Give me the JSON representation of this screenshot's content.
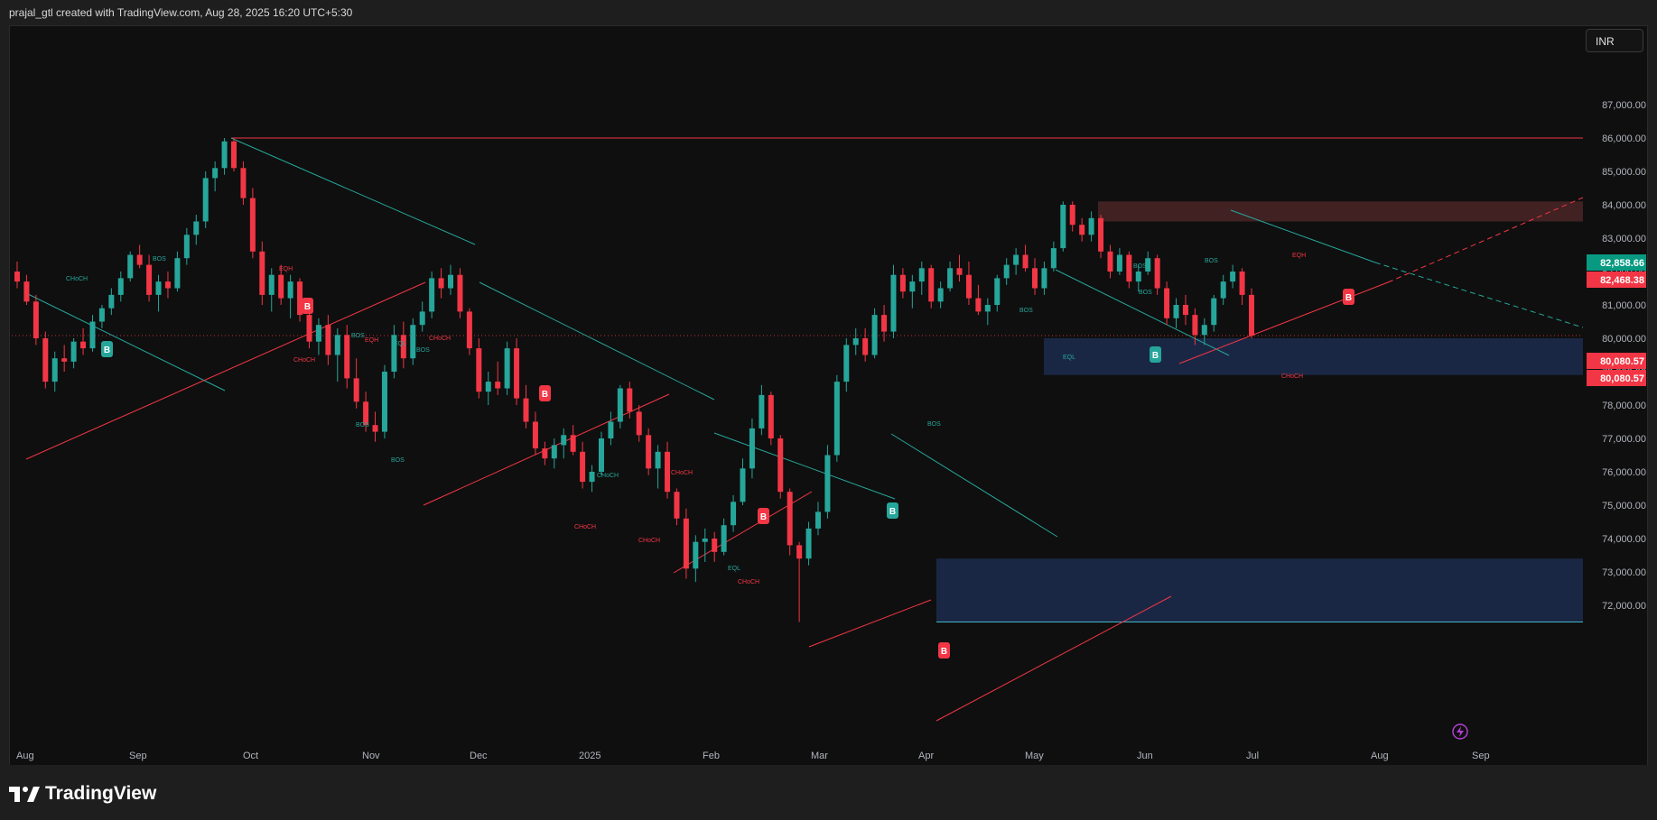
{
  "header": {
    "attribution": "prajal_gtl created with TradingView.com, Aug 28, 2025 16:20 UTC+5:30"
  },
  "currency_button": {
    "label": "INR"
  },
  "branding": {
    "logo_text": "TradingView"
  },
  "colors": {
    "background": "#0f0f0f",
    "bull": "#26a69a",
    "bear": "#f23645",
    "demand_zone": "#1c2b4e",
    "supply_zone": "#4a2426",
    "grid_text": "#b2b5be"
  },
  "chart_data": {
    "type": "candlestick",
    "symbol": "",
    "ylim": [
      71500,
      88300
    ],
    "y_tick_labels": [
      "72,000.00",
      "73,000.00",
      "74,000.00",
      "75,000.00",
      "76,000.00",
      "77,000.00",
      "78,000.00",
      "79,000.00",
      "80,000.00",
      "81,000.00",
      "82,000.00",
      "83,000.00",
      "84,000.00",
      "85,000.00",
      "86,000.00",
      "87,000.00"
    ],
    "y_tick_values": [
      72000,
      73000,
      74000,
      75000,
      76000,
      77000,
      78000,
      79000,
      80000,
      81000,
      82000,
      83000,
      84000,
      85000,
      86000,
      87000
    ],
    "x_tick_labels": [
      "Aug",
      "Sep",
      "Oct",
      "Nov",
      "Dec",
      "2025",
      "Feb",
      "Mar",
      "Apr",
      "May",
      "Jun",
      "Jul",
      "Aug",
      "Sep"
    ],
    "price_labels": [
      {
        "value": 82858.66,
        "text": "82,858.66",
        "color": "#089981"
      },
      {
        "value": 82468.38,
        "text": "82,468.38",
        "color": "#f23645"
      },
      {
        "value": 80080.57,
        "text": "80,080.57",
        "color": "#f23645"
      },
      {
        "value": 80080.57,
        "text": "80,080.57",
        "color": "#f23645"
      }
    ],
    "last_price": 80080.57,
    "zones": [
      {
        "type": "supply",
        "from_date_index": 30,
        "top": 84100,
        "bottom": 83500
      },
      {
        "type": "demand",
        "from_date_index": 9,
        "top": 80000,
        "bottom": 78900
      },
      {
        "type": "demand",
        "from_date_index": 8,
        "top": 73400,
        "bottom": 71500
      }
    ],
    "horizontal_levels": [
      {
        "value": 86000,
        "color": "#f23645"
      }
    ],
    "structure_labels": [
      "CHoCH",
      "BOS",
      "EQH",
      "BOS",
      "CHoCH",
      "EQH",
      "CHoCH",
      "EQL",
      "BOS",
      "BOS",
      "CHoCH",
      "CHoCH",
      "CHoCH",
      "EQL",
      "CHoCH",
      "BOS",
      "BOS",
      "BOS",
      "EQL",
      "BOS",
      "EQH",
      "CHoCH",
      "BOS",
      "CHoCH",
      "BOS"
    ],
    "signals": [
      "B",
      "B",
      "B",
      "B",
      "B",
      "B",
      "B",
      "B"
    ],
    "candles": [
      [
        82000,
        82300,
        81500,
        81700
      ],
      [
        81700,
        81900,
        81000,
        81100
      ],
      [
        81100,
        81300,
        79800,
        80000
      ],
      [
        80000,
        80200,
        78500,
        78700
      ],
      [
        78700,
        79600,
        78400,
        79400
      ],
      [
        79400,
        79800,
        79000,
        79300
      ],
      [
        79300,
        80000,
        79100,
        79900
      ],
      [
        79900,
        80300,
        79500,
        79700
      ],
      [
        79700,
        80700,
        79600,
        80500
      ],
      [
        80500,
        81000,
        80300,
        80900
      ],
      [
        80900,
        81500,
        80700,
        81300
      ],
      [
        81300,
        82000,
        81100,
        81800
      ],
      [
        81800,
        82600,
        81700,
        82500
      ],
      [
        82500,
        82800,
        82100,
        82200
      ],
      [
        82200,
        82500,
        81100,
        81300
      ],
      [
        81300,
        81900,
        80800,
        81700
      ],
      [
        81700,
        82000,
        81200,
        81500
      ],
      [
        81500,
        82600,
        81400,
        82400
      ],
      [
        82400,
        83300,
        82200,
        83100
      ],
      [
        83100,
        83700,
        82800,
        83500
      ],
      [
        83500,
        85000,
        83300,
        84800
      ],
      [
        84800,
        85300,
        84400,
        85100
      ],
      [
        85100,
        86000,
        84900,
        85900
      ],
      [
        85900,
        86000,
        85000,
        85100
      ],
      [
        85100,
        85300,
        84000,
        84200
      ],
      [
        84200,
        84500,
        82400,
        82600
      ],
      [
        82600,
        82900,
        81000,
        81300
      ],
      [
        81300,
        82100,
        80800,
        81900
      ],
      [
        81900,
        82200,
        81000,
        81200
      ],
      [
        81200,
        81900,
        80600,
        81700
      ],
      [
        81700,
        81800,
        80500,
        80700
      ],
      [
        80700,
        81100,
        79700,
        79900
      ],
      [
        79900,
        80600,
        79500,
        80400
      ],
      [
        80400,
        80700,
        79200,
        79500
      ],
      [
        79500,
        80300,
        78700,
        80100
      ],
      [
        80100,
        80400,
        78500,
        78800
      ],
      [
        78800,
        79400,
        77900,
        78100
      ],
      [
        78100,
        78400,
        77200,
        77400
      ],
      [
        77400,
        77800,
        76900,
        77200
      ],
      [
        77200,
        79200,
        77000,
        79000
      ],
      [
        79000,
        80400,
        78800,
        80100
      ],
      [
        80100,
        80500,
        79100,
        79400
      ],
      [
        79400,
        80600,
        79200,
        80400
      ],
      [
        80400,
        81100,
        80200,
        80800
      ],
      [
        80800,
        82000,
        80600,
        81800
      ],
      [
        81800,
        82100,
        81200,
        81500
      ],
      [
        81500,
        82200,
        81300,
        81900
      ],
      [
        81900,
        82100,
        80600,
        80800
      ],
      [
        80800,
        80900,
        79500,
        79700
      ],
      [
        79700,
        80000,
        78200,
        78400
      ],
      [
        78400,
        79000,
        78000,
        78700
      ],
      [
        78700,
        79300,
        78300,
        78500
      ],
      [
        78500,
        79900,
        78300,
        79700
      ],
      [
        79700,
        80000,
        78000,
        78200
      ],
      [
        78200,
        78600,
        77300,
        77500
      ],
      [
        77500,
        77800,
        76500,
        76700
      ],
      [
        76700,
        76900,
        76200,
        76400
      ],
      [
        76400,
        77000,
        76100,
        76800
      ],
      [
        76800,
        77300,
        76400,
        77100
      ],
      [
        77100,
        77400,
        76500,
        76600
      ],
      [
        76600,
        76900,
        75500,
        75700
      ],
      [
        75700,
        76200,
        75400,
        76000
      ],
      [
        76000,
        77200,
        75900,
        77000
      ],
      [
        77000,
        77800,
        76800,
        77500
      ],
      [
        77500,
        78600,
        77300,
        78500
      ],
      [
        78500,
        78700,
        77600,
        77800
      ],
      [
        77800,
        78000,
        76900,
        77100
      ],
      [
        77100,
        77300,
        75900,
        76100
      ],
      [
        76100,
        76800,
        75500,
        76600
      ],
      [
        76600,
        76900,
        75200,
        75400
      ],
      [
        75400,
        75500,
        74400,
        74600
      ],
      [
        74600,
        74900,
        72800,
        73100
      ],
      [
        73100,
        74100,
        72700,
        73900
      ],
      [
        73900,
        74300,
        73300,
        74000
      ],
      [
        74000,
        74200,
        73300,
        73600
      ],
      [
        73600,
        74600,
        73500,
        74400
      ],
      [
        74400,
        75300,
        74200,
        75100
      ],
      [
        75100,
        76400,
        75000,
        76100
      ],
      [
        76100,
        77600,
        75800,
        77300
      ],
      [
        77300,
        78600,
        77100,
        78300
      ],
      [
        78300,
        78400,
        76800,
        77000
      ],
      [
        77000,
        77100,
        75200,
        75400
      ],
      [
        75400,
        75500,
        73500,
        73800
      ],
      [
        73800,
        73900,
        71500,
        73400
      ],
      [
        73400,
        74500,
        73200,
        74300
      ],
      [
        74300,
        75100,
        74100,
        74800
      ],
      [
        74800,
        76800,
        74600,
        76500
      ],
      [
        76500,
        78900,
        76300,
        78700
      ],
      [
        78700,
        80000,
        78400,
        79800
      ],
      [
        79800,
        80300,
        79500,
        80000
      ],
      [
        80000,
        80300,
        79300,
        79500
      ],
      [
        79500,
        80900,
        79400,
        80700
      ],
      [
        80700,
        81000,
        79900,
        80200
      ],
      [
        80200,
        82200,
        80000,
        81900
      ],
      [
        81900,
        82100,
        81200,
        81400
      ],
      [
        81400,
        81900,
        80900,
        81700
      ],
      [
        81700,
        82300,
        81300,
        82100
      ],
      [
        82100,
        82200,
        80900,
        81100
      ],
      [
        81100,
        81700,
        80900,
        81500
      ],
      [
        81500,
        82300,
        81400,
        82100
      ],
      [
        82100,
        82500,
        81700,
        81900
      ],
      [
        81900,
        82300,
        81000,
        81200
      ],
      [
        81200,
        81600,
        80700,
        80800
      ],
      [
        80800,
        81200,
        80400,
        81000
      ],
      [
        81000,
        81900,
        80800,
        81800
      ],
      [
        81800,
        82400,
        81600,
        82200
      ],
      [
        82200,
        82700,
        81900,
        82500
      ],
      [
        82500,
        82800,
        82000,
        82100
      ],
      [
        82100,
        82400,
        81300,
        81500
      ],
      [
        81500,
        82300,
        81300,
        82100
      ],
      [
        82100,
        82900,
        82000,
        82700
      ],
      [
        82700,
        84100,
        82600,
        84000
      ],
      [
        84000,
        84100,
        83200,
        83400
      ],
      [
        83400,
        83600,
        82900,
        83100
      ],
      [
        83100,
        83800,
        82900,
        83600
      ],
      [
        83600,
        83700,
        82400,
        82600
      ],
      [
        82600,
        82800,
        81800,
        82000
      ],
      [
        82000,
        82700,
        81900,
        82500
      ],
      [
        82500,
        82600,
        81500,
        81700
      ],
      [
        81700,
        82200,
        81400,
        82000
      ],
      [
        82000,
        82600,
        81900,
        82400
      ],
      [
        82400,
        82500,
        81300,
        81500
      ],
      [
        81500,
        81700,
        80400,
        80600
      ],
      [
        80600,
        81200,
        80300,
        81000
      ],
      [
        81000,
        81300,
        80400,
        80700
      ],
      [
        80700,
        80900,
        79800,
        80100
      ],
      [
        80100,
        80600,
        79800,
        80400
      ],
      [
        80400,
        81300,
        80200,
        81200
      ],
      [
        81200,
        81900,
        81000,
        81700
      ],
      [
        81700,
        82200,
        81500,
        82000
      ],
      [
        82000,
        82100,
        81000,
        81300
      ],
      [
        81300,
        81500,
        80000,
        80080
      ]
    ]
  }
}
